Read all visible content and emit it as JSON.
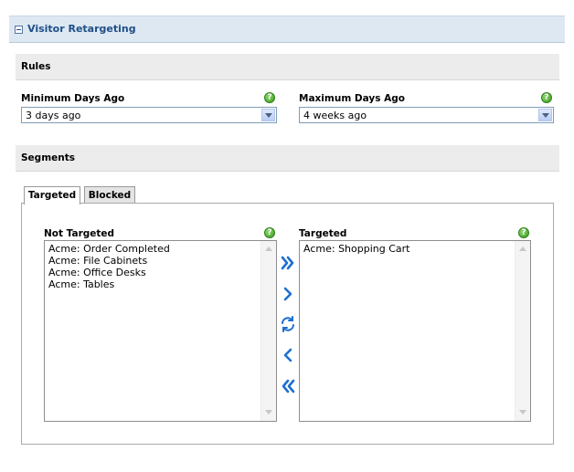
{
  "panel": {
    "title": "Visitor Retargeting"
  },
  "rules": {
    "title": "Rules",
    "min_days": {
      "label": "Minimum Days Ago",
      "value": "3 days ago"
    },
    "max_days": {
      "label": "Maximum Days Ago",
      "value": "4 weeks ago"
    },
    "help_glyph": "?"
  },
  "segments": {
    "title": "Segments",
    "tabs": [
      {
        "label": "Targeted",
        "active": true
      },
      {
        "label": "Blocked",
        "active": false
      }
    ],
    "not_targeted": {
      "label": "Not Targeted",
      "items": [
        "Acme: Order Completed",
        "Acme: File Cabinets",
        "Acme: Office Desks",
        "Acme: Tables"
      ]
    },
    "targeted": {
      "label": "Targeted",
      "items": [
        "Acme: Shopping Cart"
      ]
    },
    "move_buttons": [
      {
        "name": "move-all-right-button",
        "icon": "double-chevron-right-icon"
      },
      {
        "name": "move-right-button",
        "icon": "chevron-right-icon"
      },
      {
        "name": "swap-button",
        "icon": "refresh-icon"
      },
      {
        "name": "move-left-button",
        "icon": "chevron-left-icon"
      },
      {
        "name": "move-all-left-button",
        "icon": "double-chevron-left-icon"
      }
    ]
  },
  "colors": {
    "header_bg": "#dde8f3",
    "title_blue": "#1f4f86",
    "section_bg": "#ececec",
    "help_green": "#3d9c22",
    "arrow_blue": "#1f6fd1"
  }
}
